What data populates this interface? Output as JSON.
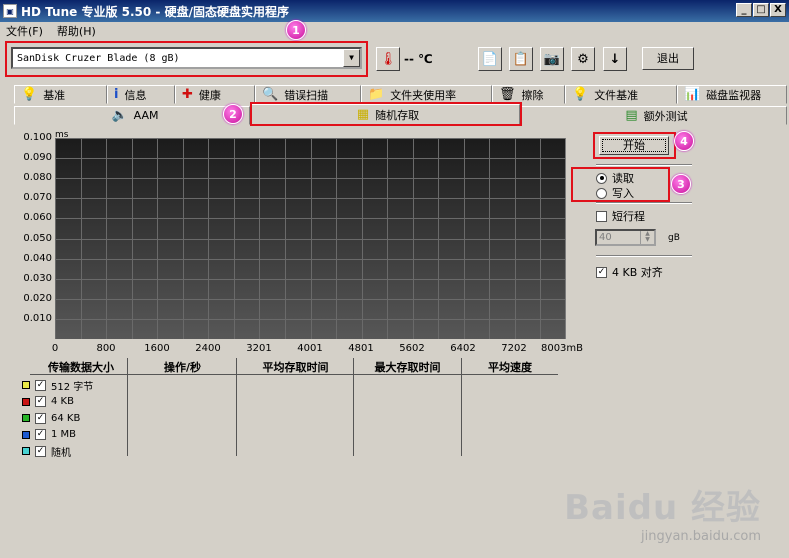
{
  "window": {
    "title": "HD Tune 专业版 5.50 - 硬盘/固态硬盘实用程序",
    "min": "_",
    "max": "□",
    "close": "X"
  },
  "menu": [
    "文件(F)",
    "帮助(H)"
  ],
  "toolbar": {
    "drive": "SanDisk Cruzer Blade (8 gB)",
    "temp": "-- ℃",
    "exit": "退出"
  },
  "tabs_row1": [
    "基准",
    "信息",
    "健康",
    "错误扫描",
    "文件夹使用率",
    "擦除",
    "文件基准",
    "磁盘监视器"
  ],
  "tabs_row2": [
    "AAM",
    "随机存取",
    "额外测试"
  ],
  "badges": [
    "1",
    "2",
    "3",
    "4"
  ],
  "chart_data": {
    "type": "line",
    "yunit": "ms",
    "yticks": [
      "0.100",
      "0.090",
      "0.080",
      "0.070",
      "0.060",
      "0.050",
      "0.040",
      "0.030",
      "0.020",
      "0.010"
    ],
    "xticks": [
      "0",
      "800",
      "1600",
      "2400",
      "3201",
      "4001",
      "4801",
      "5602",
      "6402",
      "7202",
      "8003mB"
    ],
    "ylim": [
      0,
      0.1
    ],
    "series": []
  },
  "table": {
    "headers": [
      "传输数据大小",
      "操作/秒",
      "平均存取时间",
      "最大存取时间",
      "平均速度"
    ],
    "rows": [
      {
        "label": "512 字节",
        "color": "#e8e848"
      },
      {
        "label": "4 KB",
        "color": "#c81414"
      },
      {
        "label": "64 KB",
        "color": "#28b428"
      },
      {
        "label": "1 MB",
        "color": "#1c5ad2"
      },
      {
        "label": "随机",
        "color": "#48d2d2"
      }
    ]
  },
  "right": {
    "start": "开始",
    "read": "读取",
    "write": "写入",
    "short_stroke": "短行程",
    "spin_value": "40",
    "spin_unit": "gB",
    "align": "4 KB 对齐"
  },
  "watermark": {
    "main": "Baidu 经验",
    "url": "jingyan.baidu.com"
  }
}
